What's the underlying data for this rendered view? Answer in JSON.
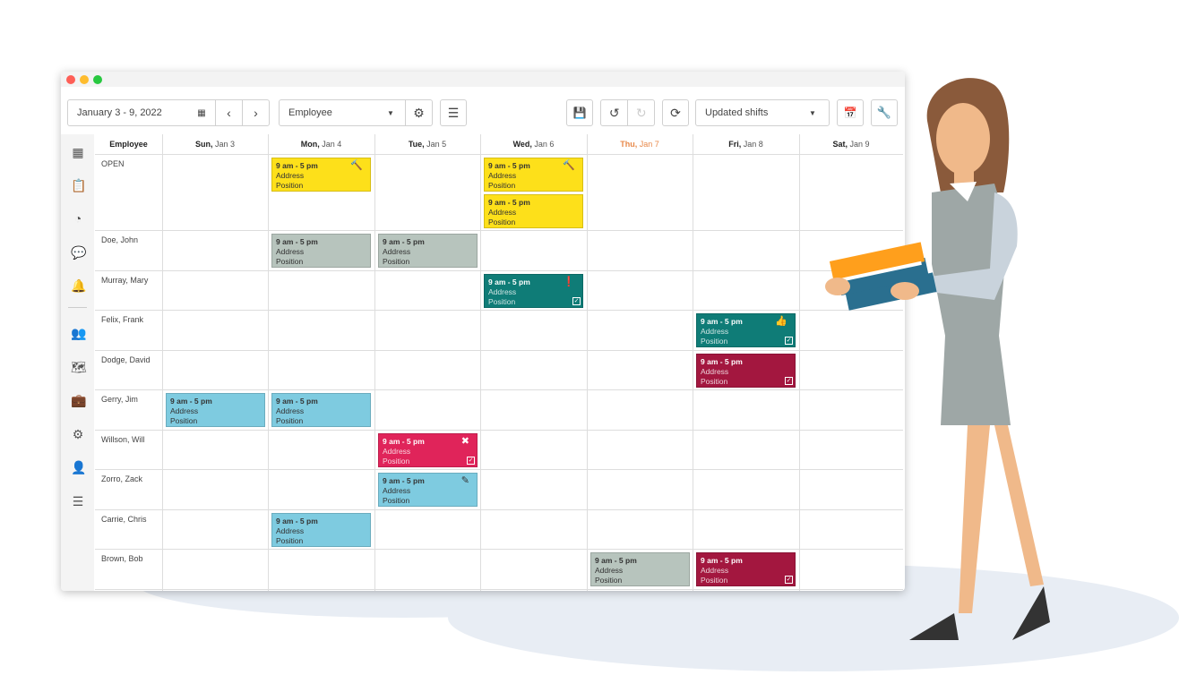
{
  "toolbar": {
    "date_range": "January 3 - 9, 2022",
    "group_by": "Employee",
    "filter": "Updated shifts"
  },
  "colors": {
    "yellow": "#fde01a",
    "gray": "#b7c4bd",
    "teal": "#0f7c77",
    "crimson": "#a3173f",
    "blue": "#7ecbe0",
    "red": "#e0245a",
    "today": "#e8894a"
  },
  "header": {
    "employee": "Employee",
    "days": [
      {
        "d": "Sun,",
        "date": " Jan 3"
      },
      {
        "d": "Mon,",
        "date": " Jan 4"
      },
      {
        "d": "Tue,",
        "date": " Jan 5"
      },
      {
        "d": "Wed,",
        "date": " Jan 6"
      },
      {
        "d": "Thu,",
        "date": " Jan 7",
        "today": true
      },
      {
        "d": "Fri,",
        "date": " Jan 8"
      },
      {
        "d": "Sat,",
        "date": " Jan 9"
      }
    ]
  },
  "employees": [
    "OPEN",
    "Doe, John",
    "Murray, Mary",
    "Felix, Frank",
    "Dodge, David",
    "Gerry, Jim",
    "Willson, Will",
    "Zorro, Zack",
    "Carrie, Chris",
    "Brown, Bob"
  ],
  "shifts": [
    {
      "row": 0,
      "day": 1,
      "color": "yellow",
      "time": "9 am - 5 pm",
      "address": "Address",
      "position": "Position",
      "icon": "gavel-icon"
    },
    {
      "row": 0,
      "day": 3,
      "color": "yellow",
      "time": "9 am - 5 pm",
      "address": "Address",
      "position": "Position",
      "icon": "gavel-plus-icon"
    },
    {
      "row": 0,
      "day": 3,
      "color": "yellow",
      "time": "9 am - 5 pm",
      "address": "Address",
      "position": "Position",
      "stack": 1
    },
    {
      "row": 1,
      "day": 1,
      "color": "gray",
      "time": "9 am - 5 pm",
      "address": "Address",
      "position": "Position"
    },
    {
      "row": 1,
      "day": 2,
      "color": "gray",
      "time": "9 am - 5 pm",
      "address": "Address",
      "position": "Position"
    },
    {
      "row": 2,
      "day": 3,
      "color": "teal",
      "time": "9 am - 5 pm",
      "address": "Address",
      "position": "Position",
      "icon": "alert-icon",
      "checked": true
    },
    {
      "row": 3,
      "day": 5,
      "color": "teal",
      "time": "9 am - 5 pm",
      "address": "Address",
      "position": "Position",
      "icon": "thumbs-up-icon",
      "checked": true
    },
    {
      "row": 4,
      "day": 5,
      "color": "crimson",
      "time": "9 am - 5 pm",
      "address": "Address",
      "position": "Position",
      "checked": true
    },
    {
      "row": 5,
      "day": 0,
      "color": "blue",
      "time": "9 am - 5 pm",
      "address": "Address",
      "position": "Position"
    },
    {
      "row": 5,
      "day": 1,
      "color": "blue",
      "time": "9 am - 5 pm",
      "address": "Address",
      "position": "Position"
    },
    {
      "row": 6,
      "day": 2,
      "color": "red",
      "time": "9 am - 5 pm",
      "address": "Address",
      "position": "Position",
      "icon": "user-remove-icon",
      "checked": true
    },
    {
      "row": 7,
      "day": 2,
      "color": "blue",
      "time": "9 am - 5 pm",
      "address": "Address",
      "position": "Position",
      "icon": "edit-icon"
    },
    {
      "row": 8,
      "day": 1,
      "color": "blue",
      "time": "9 am - 5 pm",
      "address": "Address",
      "position": "Position"
    },
    {
      "row": 9,
      "day": 4,
      "color": "gray",
      "time": "9 am - 5 pm",
      "address": "Address",
      "position": "Position"
    },
    {
      "row": 9,
      "day": 5,
      "color": "crimson",
      "time": "9 am - 5 pm",
      "address": "Address",
      "position": "Position",
      "checked": true
    }
  ],
  "sidebar": [
    "grid-icon",
    "clipboard-check-icon",
    "pie-chart-icon",
    "chat-icon",
    "bell-icon",
    "users-cog-icon",
    "map-icon",
    "briefcase-icon",
    "gear-icon",
    "user-icon",
    "list-icon"
  ]
}
